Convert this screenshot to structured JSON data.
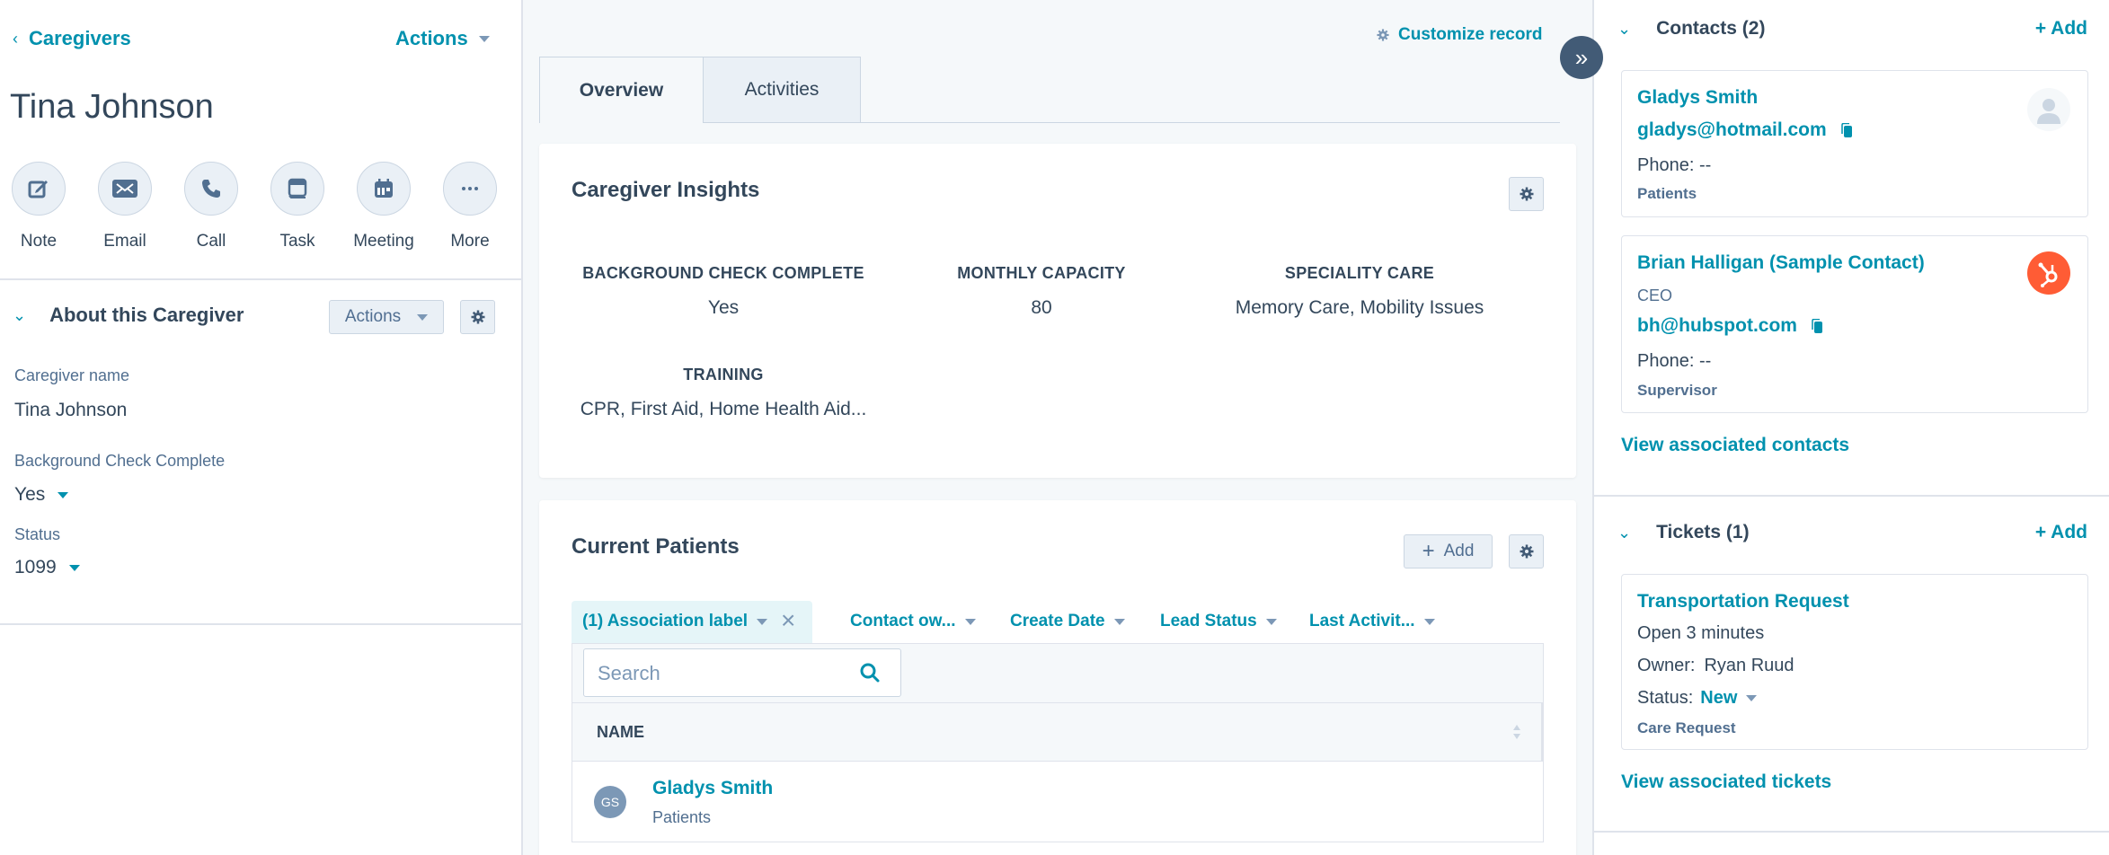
{
  "left": {
    "back_label": "Caregivers",
    "actions_label": "Actions",
    "record_name": "Tina Johnson",
    "activity_buttons": [
      {
        "label": "Note",
        "icon": "note-icon"
      },
      {
        "label": "Email",
        "icon": "email-icon"
      },
      {
        "label": "Call",
        "icon": "call-icon"
      },
      {
        "label": "Task",
        "icon": "task-icon"
      },
      {
        "label": "Meeting",
        "icon": "meeting-icon"
      },
      {
        "label": "More",
        "icon": "more-icon"
      }
    ],
    "about": {
      "title": "About this Caregiver",
      "actions_label": "Actions",
      "properties": [
        {
          "label": "Caregiver name",
          "value": "Tina Johnson"
        },
        {
          "label": "Background Check Complete",
          "value": "Yes"
        },
        {
          "label": "Status",
          "value": "1099"
        }
      ]
    }
  },
  "middle": {
    "customize_label": "Customize record",
    "tabs": [
      {
        "label": "Overview",
        "active": true
      },
      {
        "label": "Activities",
        "active": false
      }
    ],
    "insights": {
      "title": "Caregiver Insights",
      "items": [
        {
          "key": "BACKGROUND CHECK COMPLETE",
          "value": "Yes"
        },
        {
          "key": "MONTHLY CAPACITY",
          "value": "80"
        },
        {
          "key": "SPECIALITY CARE",
          "value": "Memory Care, Mobility Issues"
        },
        {
          "key": "TRAINING",
          "value": "CPR, First Aid, Home Health Aid..."
        }
      ]
    },
    "patients": {
      "title": "Current Patients",
      "add_label": "Add",
      "filters": [
        {
          "label": "(1) Association label",
          "active": true
        },
        {
          "label": "Contact ow...",
          "active": false
        },
        {
          "label": "Create Date",
          "active": false
        },
        {
          "label": "Lead Status",
          "active": false
        },
        {
          "label": "Last Activit...",
          "active": false
        }
      ],
      "search_placeholder": "Search",
      "columns": [
        "NAME"
      ],
      "rows": [
        {
          "initials": "GS",
          "name": "Gladys Smith",
          "label": "Patients"
        }
      ]
    }
  },
  "right": {
    "contacts": {
      "title": "Contacts (2)",
      "add_label": "+ Add",
      "items": [
        {
          "name": "Gladys Smith",
          "email": "gladys@hotmail.com",
          "phone": "Phone: --",
          "tag": "Patients"
        },
        {
          "name": "Brian Halligan (Sample Contact)",
          "title": "CEO",
          "email": "bh@hubspot.com",
          "phone": "Phone: --",
          "tag": "Supervisor"
        }
      ],
      "view_all": "View associated contacts"
    },
    "tickets": {
      "title": "Tickets (1)",
      "add_label": "+ Add",
      "items": [
        {
          "name": "Transportation Request",
          "open": "Open 3 minutes",
          "owner_label": "Owner:",
          "owner": "Ryan Ruud",
          "status_label": "Status:",
          "status": "New",
          "tag": "Care Request"
        }
      ],
      "view_all": "View associated tickets"
    }
  },
  "colors": {
    "accent": "#0091ae",
    "text": "#33475b",
    "hubspot_orange": "#ff5c35",
    "expand_button": "#425b76"
  }
}
